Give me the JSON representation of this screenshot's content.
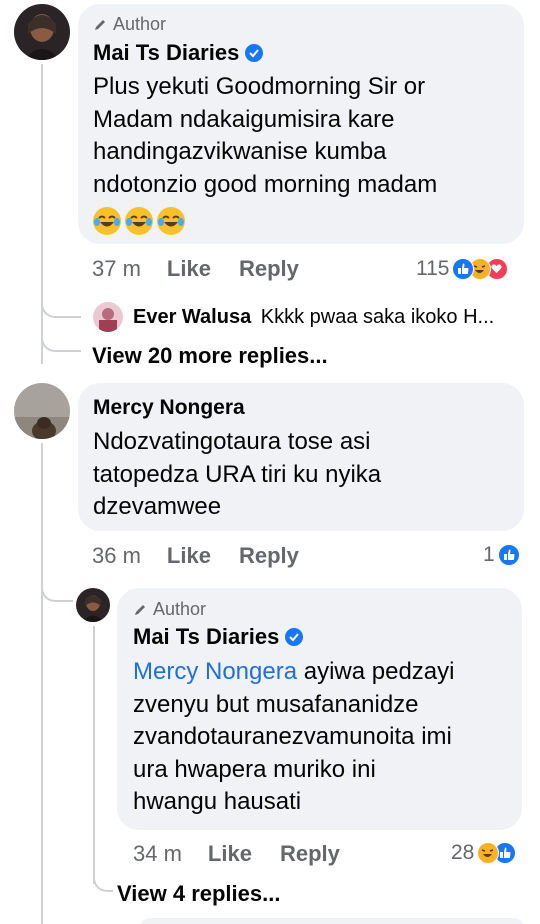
{
  "comments": [
    {
      "author_tag": "Author",
      "name": "Mai Ts Diaries",
      "text_lines": [
        "Plus yekuti Goodmorning Sir or",
        "Madam ndakaigumisira kare",
        "handingazvikwanise kumba",
        "ndotonzio good morning madam"
      ],
      "emoji": [
        "tears-of-joy",
        "tears-of-joy",
        "tears-of-joy"
      ],
      "time": "37 m",
      "like": "Like",
      "reply": "Reply",
      "reaction_count": "115",
      "reactions": [
        "like",
        "haha",
        "love"
      ],
      "reply_preview": {
        "name": "Ever Walusa",
        "text": "Kkkk pwaa saka ikoko H..."
      },
      "view_more": "View 20 more replies..."
    },
    {
      "name": "Mercy Nongera",
      "text_lines": [
        "Ndozvatingotaura tose asi",
        "tatopedza URA tiri ku nyika",
        "dzevamwee"
      ],
      "time": "36 m",
      "like": "Like",
      "reply": "Reply",
      "reaction_count": "1",
      "reactions": [
        "like"
      ]
    }
  ],
  "reply": {
    "author_tag": "Author",
    "name": "Mai Ts Diaries",
    "mention": "Mercy Nongera",
    "text_first": " ayiwa pedzayi",
    "text_lines": [
      "zvenyu but musafananidze",
      "zvandotauranezvamunoita imi",
      "ura hwapera muriko ini",
      "hwangu hausati"
    ],
    "time": "34 m",
    "like": "Like",
    "reply": "Reply",
    "reaction_count": "28",
    "reactions": [
      "haha",
      "like"
    ],
    "view_more": "View 4 replies..."
  },
  "colors": {
    "like": "#1877f2",
    "haha": "#f7b125",
    "love": "#f33e58",
    "mention": "#216fdb",
    "bubble": "#f0f2f5"
  }
}
